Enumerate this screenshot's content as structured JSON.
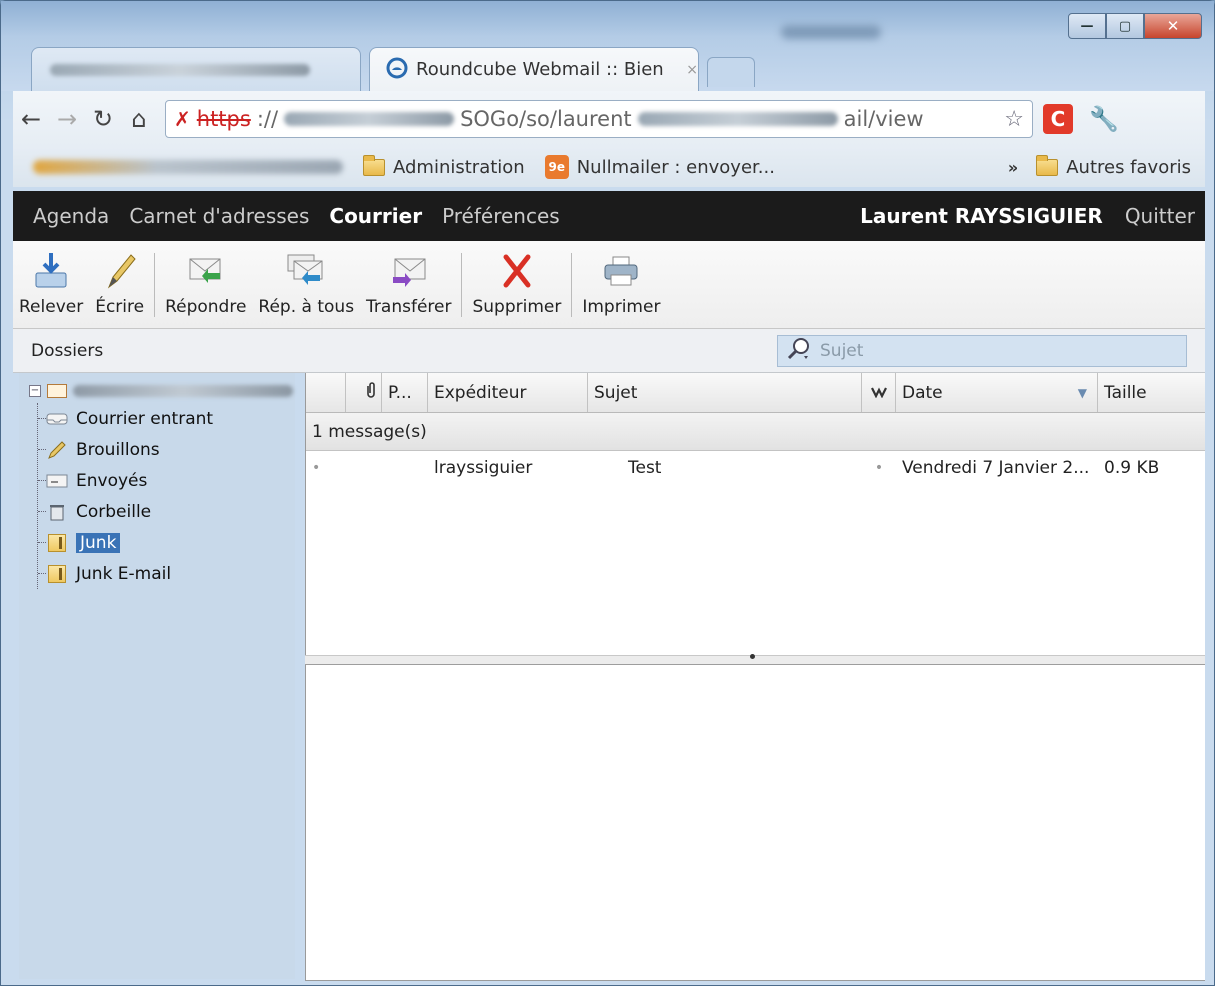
{
  "browser": {
    "active_tab_title": "Roundcube Webmail :: Bien",
    "tab_close_glyph": "×",
    "address": {
      "scheme": "https",
      "separator": "://",
      "path_part": "SOGo/so/laurent",
      "tail": "ail/view"
    },
    "bookmarks": [
      {
        "label": "Administration",
        "icon": "folder-icon"
      },
      {
        "label": "Nullmailer : envoyer...",
        "icon": "nullmailer-icon"
      }
    ],
    "bookmarks_more": "»",
    "other_bookmarks": "Autres favoris",
    "extension_letter": "C"
  },
  "sogo_nav": {
    "links": [
      "Agenda",
      "Carnet d'adresses",
      "Courrier",
      "Préférences"
    ],
    "active": "Courrier",
    "user": "Laurent RAYSSIGUIER",
    "quit": "Quitter"
  },
  "toolbar": {
    "relever": "Relever",
    "ecrire": "Écrire",
    "repondre": "Répondre",
    "rep_tous": "Rép. à tous",
    "transferer": "Transférer",
    "supprimer": "Supprimer",
    "imprimer": "Imprimer"
  },
  "folders_bar": {
    "label": "Dossiers",
    "search_placeholder": "Sujet"
  },
  "folders": [
    {
      "label": "Courrier entrant",
      "icon": "inbox-icon"
    },
    {
      "label": "Brouillons",
      "icon": "pencil-icon"
    },
    {
      "label": "Envoyés",
      "icon": "sent-icon"
    },
    {
      "label": "Corbeille",
      "icon": "trash-icon"
    },
    {
      "label": "Junk",
      "icon": "junk-folder-icon",
      "selected": true
    },
    {
      "label": "Junk E-mail",
      "icon": "junk-folder-icon"
    }
  ],
  "message_list": {
    "columns": {
      "priority": "P...",
      "from": "Expéditeur",
      "subject": "Sujet",
      "date": "Date",
      "size": "Taille"
    },
    "group_label": "1 message(s)",
    "rows": [
      {
        "from": "lrayssiguier",
        "subject": "Test",
        "date": "Vendredi 7 Janvier 2...",
        "size": "0.9 KB"
      }
    ]
  },
  "colors": {
    "nav_bg": "#1b1b1b",
    "sidebar_bg": "#c8d9ea",
    "selected": "#3a73b6",
    "delete_red": "#d93025"
  }
}
